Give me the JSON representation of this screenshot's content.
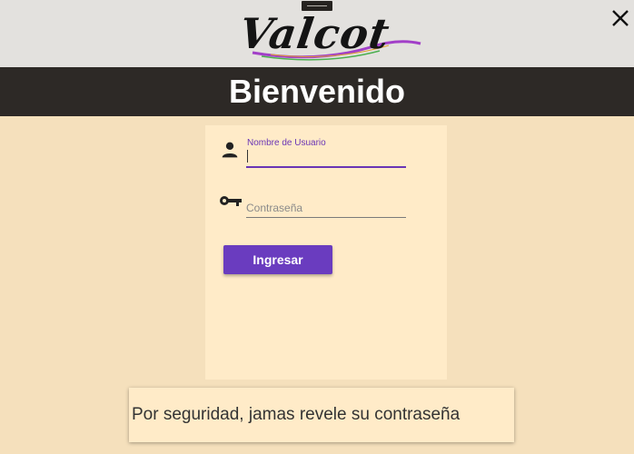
{
  "app": {
    "logo_text": "Valcot"
  },
  "header": {
    "title": "Bienvenido"
  },
  "login": {
    "username_label": "Nombre de Usuario",
    "username_value": "",
    "password_placeholder": "Contraseña",
    "password_value": "",
    "submit_label": "Ingresar"
  },
  "notice": {
    "text": "Por seguridad, jamas revele su contraseña"
  },
  "icons": {
    "user": "person-icon",
    "password": "key-icon",
    "close": "close-icon"
  },
  "colors": {
    "accent": "#6a3cbf",
    "header_bg": "#2d2926",
    "page_bg": "#f5e0bc",
    "card_bg": "#ffebc8"
  }
}
